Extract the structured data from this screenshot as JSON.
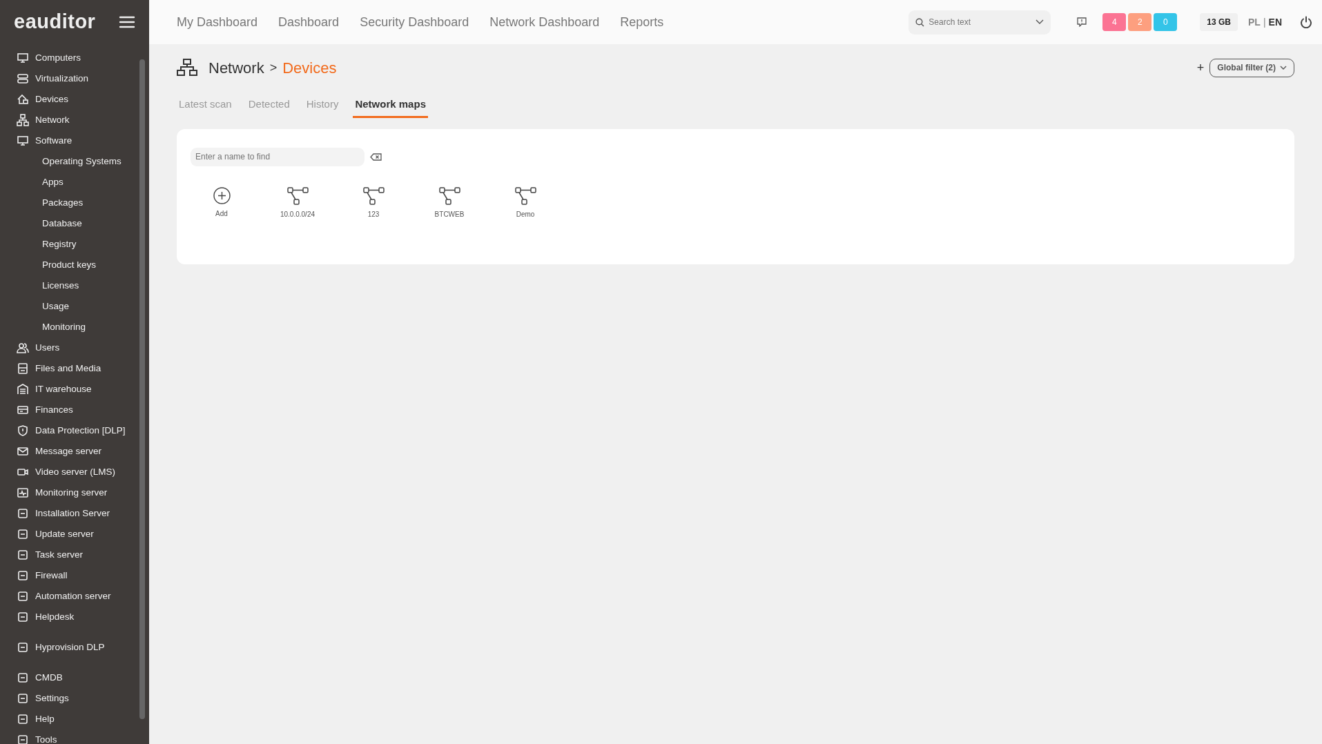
{
  "logo": {
    "text": "eauditor"
  },
  "sidebar": {
    "sections": [
      {
        "items": [
          {
            "label": "Computers",
            "kind": "main"
          },
          {
            "label": "Virtualization",
            "kind": "main"
          },
          {
            "label": "Devices",
            "kind": "main"
          },
          {
            "label": "Network",
            "kind": "main"
          },
          {
            "label": "Software",
            "kind": "main"
          },
          {
            "label": "Operating Systems",
            "kind": "sub"
          },
          {
            "label": "Apps",
            "kind": "sub"
          },
          {
            "label": "Packages",
            "kind": "sub"
          },
          {
            "label": "Database",
            "kind": "sub"
          },
          {
            "label": "Registry",
            "kind": "sub"
          },
          {
            "label": "Product keys",
            "kind": "sub"
          },
          {
            "label": "Licenses",
            "kind": "sub"
          },
          {
            "label": "Usage",
            "kind": "sub"
          },
          {
            "label": "Monitoring",
            "kind": "sub"
          },
          {
            "label": "Users",
            "kind": "main"
          },
          {
            "label": "Files and Media",
            "kind": "main"
          },
          {
            "label": "IT warehouse",
            "kind": "main"
          },
          {
            "label": "Finances",
            "kind": "main"
          },
          {
            "label": "Data Protection [DLP]",
            "kind": "main"
          },
          {
            "label": "Message server",
            "kind": "main"
          },
          {
            "label": "Video server (LMS)",
            "kind": "main"
          },
          {
            "label": "Monitoring server",
            "kind": "main"
          },
          {
            "label": "Installation Server",
            "kind": "main"
          },
          {
            "label": "Update server",
            "kind": "main"
          },
          {
            "label": "Task server",
            "kind": "main"
          },
          {
            "label": "Firewall",
            "kind": "main"
          },
          {
            "label": "Automation server",
            "kind": "main"
          },
          {
            "label": "Helpdesk",
            "kind": "main"
          }
        ]
      },
      {
        "items": [
          {
            "label": "Hyprovision DLP",
            "kind": "main"
          }
        ]
      },
      {
        "items": [
          {
            "label": "CMDB",
            "kind": "main"
          },
          {
            "label": "Settings",
            "kind": "main"
          },
          {
            "label": "Help",
            "kind": "main"
          },
          {
            "label": "Tools",
            "kind": "main"
          }
        ]
      }
    ]
  },
  "top_nav": [
    "My Dashboard",
    "Dashboard",
    "Security Dashboard",
    "Network Dashboard",
    "Reports"
  ],
  "search": {
    "placeholder": "Search text"
  },
  "badges": [
    {
      "text": "4",
      "color": "#fb7393"
    },
    {
      "text": "2",
      "color": "#fd9f7f"
    },
    {
      "text": "0",
      "color": "#33c4e8"
    }
  ],
  "storage": "13 GB",
  "languages": [
    {
      "code": "PL",
      "selected": false
    },
    {
      "code": "EN",
      "selected": true
    }
  ],
  "language_separator": "|",
  "breadcrumb": {
    "parent": "Network",
    "separator": ">",
    "current": "Devices"
  },
  "global_filter": {
    "label": "Global filter (2)"
  },
  "add_filter": "+",
  "tabs": [
    {
      "label": "Latest scan",
      "selected": false
    },
    {
      "label": "Detected",
      "selected": false
    },
    {
      "label": "History",
      "selected": false
    },
    {
      "label": "Network maps",
      "selected": true
    }
  ],
  "map_search": {
    "placeholder": "Enter a name to find"
  },
  "maps": [
    {
      "label": "Add",
      "kind": "add"
    },
    {
      "label": "10.0.0.0/24",
      "kind": "map"
    },
    {
      "label": "123",
      "kind": "map"
    },
    {
      "label": "BTCWEB",
      "kind": "map"
    },
    {
      "label": "Demo",
      "kind": "map"
    }
  ]
}
